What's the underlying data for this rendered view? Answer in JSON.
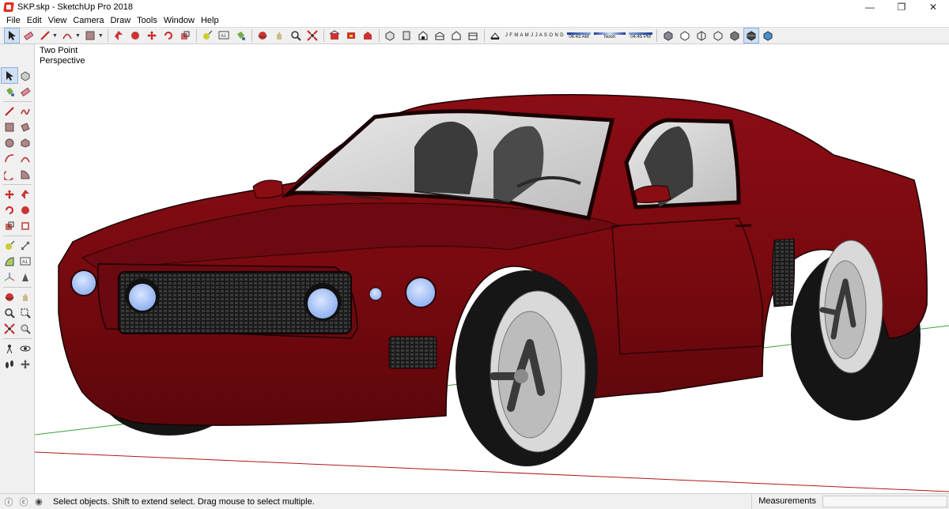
{
  "window": {
    "title": "SKP.skp - SketchUp Pro 2018",
    "controls": {
      "minimize": "—",
      "maximize": "❐",
      "close": "✕"
    }
  },
  "menu": [
    "File",
    "Edit",
    "View",
    "Camera",
    "Draw",
    "Tools",
    "Window",
    "Help"
  ],
  "shadow_settings": {
    "months": "J F M A M J J A S O N D",
    "time_start": "06:43 AM",
    "time_noon": "Noon",
    "time_end": "04:45 PM"
  },
  "viewport": {
    "label_line1": "Two Point",
    "label_line2": "Perspective",
    "model_color": "#7a0a0f",
    "background": "#ffffff"
  },
  "status": {
    "hint": "Select objects. Shift to extend select. Drag mouse to select multiple.",
    "measurements_label": "Measurements",
    "measurements_value": ""
  },
  "colors": {
    "car_body": "#7d0b11",
    "car_dark": "#4a0508",
    "axis_green": "#3aa23a",
    "axis_red": "#b01818",
    "headlight": "#aec8ff"
  }
}
